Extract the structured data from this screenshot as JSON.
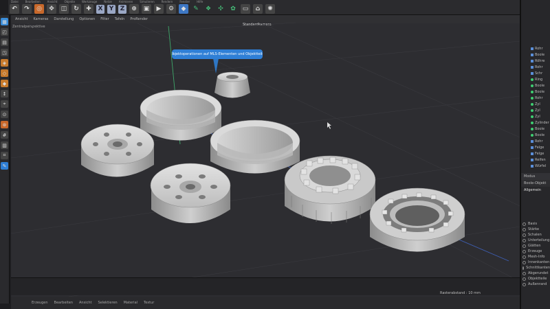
{
  "menubar": {
    "items": [
      "Datei",
      "Bearbeiten",
      "Ansicht",
      "Objekte",
      "Werkzeuge",
      "Netze",
      "Animieren",
      "Simulieren",
      "Rendern",
      "Fenster",
      "Hilfe"
    ]
  },
  "toolbar": {
    "xyz": [
      "X",
      "Y",
      "Z"
    ]
  },
  "viewport": {
    "menu_items": [
      "Ansicht",
      "Kameras",
      "Darstellung",
      "Optionen",
      "Filter",
      "Tafeln",
      "ProRender"
    ],
    "title": "Zentralperspektive",
    "camera": "Standardkamera",
    "tooltip": "Objektoperationen auf MLS-Elementen und Objektteile"
  },
  "bottombar": {
    "items": [
      "Erzeugen",
      "Bearbeiten",
      "Ansicht",
      "Selektieren",
      "Material",
      "Textur"
    ]
  },
  "timeline": {
    "readout": "Rasterabstand : 10 mm"
  },
  "rightpanel": {
    "objects": [
      "Rohr",
      "Boole",
      "Röhre",
      "Rohr",
      "Schr",
      "Ring",
      "Boole",
      "Boole",
      "Rohr",
      "Zyl",
      "Zyl",
      "Zyl",
      "Zylinder",
      "Boole",
      "Boole",
      "Rohr",
      "Felge",
      "Felge",
      "Reifen",
      "Würfel"
    ],
    "attr_mode": "Modus",
    "attr_object": "Boole-Objekt",
    "attr_section": "Allgemein",
    "attr_rows": [
      "Basis",
      "Stärke",
      "Schalen",
      "Unterteilung",
      "Glätten",
      "Erzeuge",
      "Mesh-Info",
      "Innenkanten",
      "Schnittkanten",
      "Abgerundet",
      "Objektteile",
      "Außenrand"
    ]
  },
  "colors": {
    "accent": "#2f7fd6",
    "object_active": "#3fcf72",
    "viewport_bg": "#2d2d31"
  }
}
